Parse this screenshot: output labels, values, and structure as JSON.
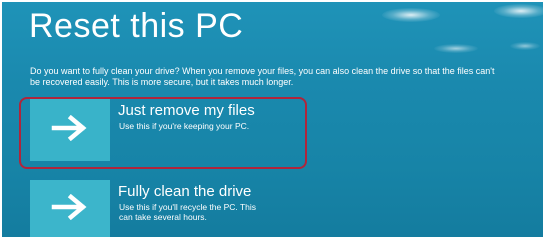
{
  "page": {
    "title": "Reset this PC",
    "description_lines": [
      "Do you want to fully clean your drive? When you remove your files, you can also clean the drive so that the files can't",
      "be recovered easily. This is more secure, but it takes much longer."
    ]
  },
  "options": [
    {
      "title": "Just remove my files",
      "desc_lines": [
        "Use this if you're keeping your PC."
      ],
      "icon": "arrow-right-icon",
      "selected": true
    },
    {
      "title": "Fully clean the drive",
      "desc_lines": [
        "Use this if you'll recycle the PC. This",
        "can take several hours."
      ],
      "icon": "arrow-right-icon",
      "selected": false
    }
  ],
  "colors": {
    "background": "#1a89ae",
    "tile": "#39b3c9",
    "highlight": "#b0253b",
    "text": "#ffffff"
  }
}
